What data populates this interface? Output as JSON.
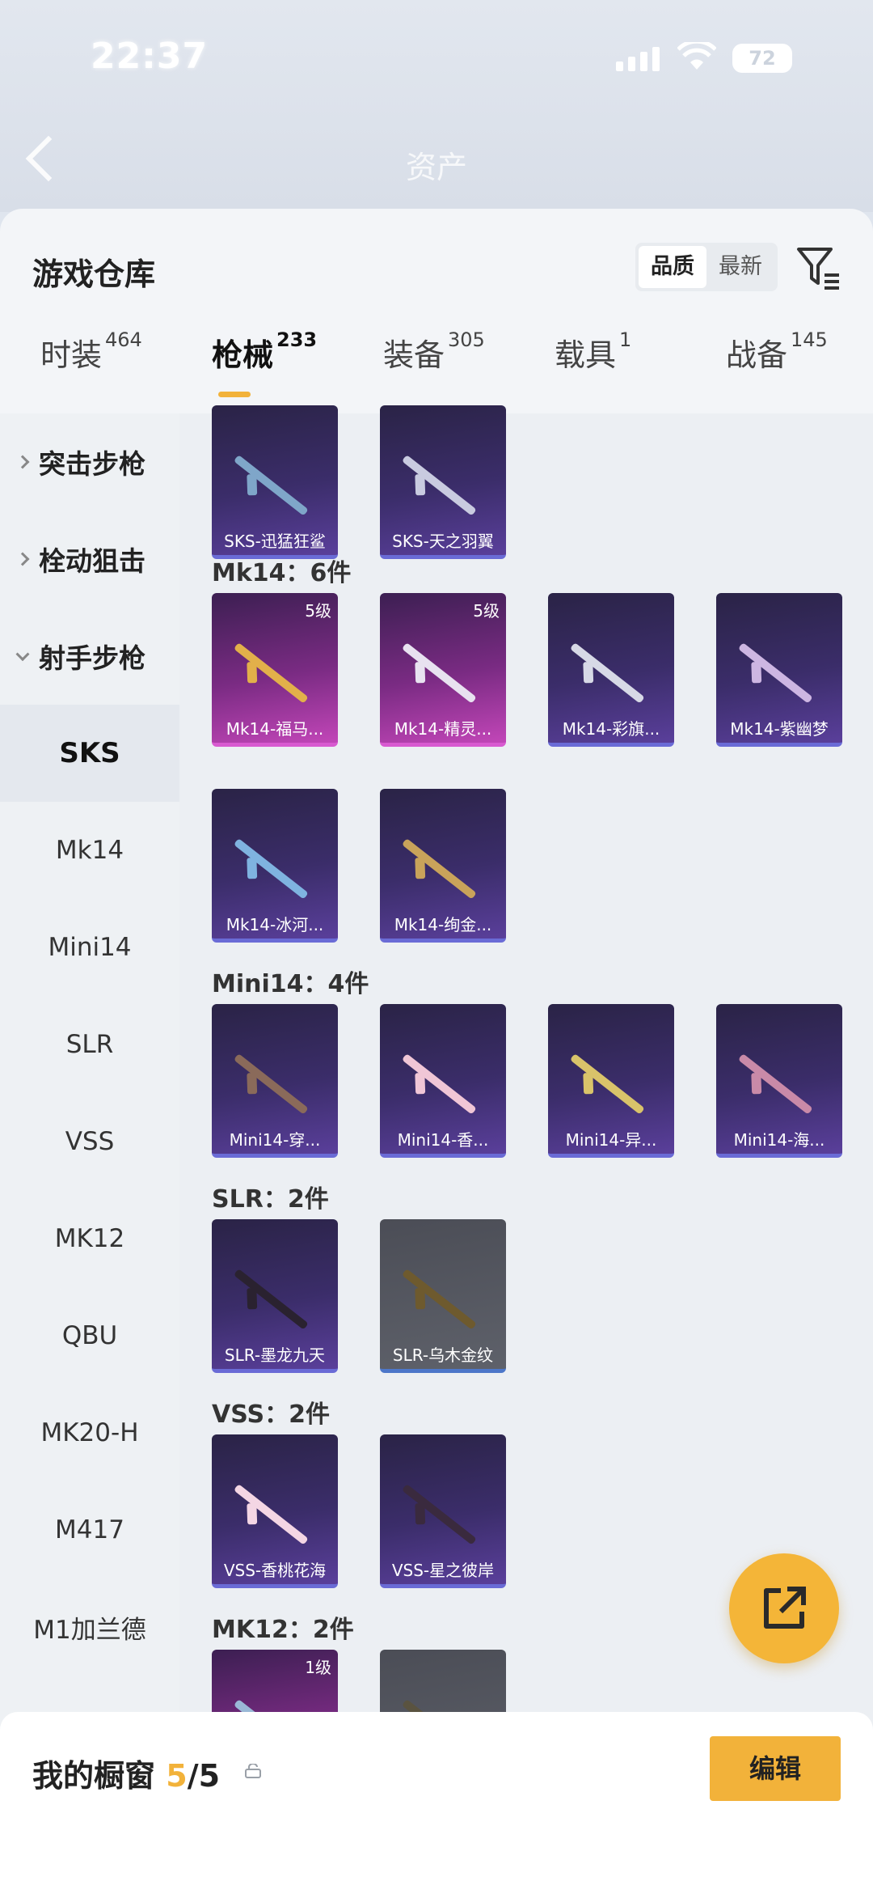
{
  "status": {
    "time": "22:37",
    "battery": "72"
  },
  "header": {
    "title": "资产"
  },
  "sheet": {
    "title": "游戏仓库",
    "sort": {
      "options": [
        "品质",
        "最新"
      ],
      "selected": "品质"
    }
  },
  "tabs": [
    {
      "label": "时装",
      "count": "464"
    },
    {
      "label": "枪械",
      "count": "233",
      "active": true
    },
    {
      "label": "装备",
      "count": "305"
    },
    {
      "label": "载具",
      "count": "1"
    },
    {
      "label": "战备",
      "count": "145"
    }
  ],
  "sidebar": {
    "categories": [
      "突击步枪",
      "栓动狙击",
      "射手步枪"
    ],
    "items": [
      "SKS",
      "Mk14",
      "Mini14",
      "SLR",
      "VSS",
      "MK12",
      "QBU",
      "MK20-H",
      "M417",
      "M1加兰德"
    ],
    "selected": "SKS"
  },
  "content": {
    "sks_cards": [
      "SKS-迅猛狂鲨",
      "SKS-天之羽翼"
    ],
    "sections": [
      {
        "title": "Mk14：6件",
        "cards": [
          {
            "name": "Mk14-福马...",
            "level": "5级"
          },
          {
            "name": "Mk14-精灵...",
            "level": "5级"
          },
          {
            "name": "Mk14-彩旗..."
          },
          {
            "name": "Mk14-紫幽梦"
          },
          {
            "name": "Mk14-冰河..."
          },
          {
            "name": "Mk14-绚金..."
          }
        ]
      },
      {
        "title": "Mini14：4件",
        "cards": [
          {
            "name": "Mini14-穿..."
          },
          {
            "name": "Mini14-香..."
          },
          {
            "name": "Mini14-异..."
          },
          {
            "name": "Mini14-海..."
          }
        ]
      },
      {
        "title": "SLR：2件",
        "cards": [
          {
            "name": "SLR-墨龙九天"
          },
          {
            "name": "SLR-乌木金纹"
          }
        ]
      },
      {
        "title": "VSS：2件",
        "cards": [
          {
            "name": "VSS-香桃花海"
          },
          {
            "name": "VSS-星之彼岸"
          }
        ]
      },
      {
        "title": "MK12：2件",
        "cards": [
          {
            "level": "1级"
          }
        ]
      }
    ]
  },
  "bottom": {
    "label": "我的橱窗",
    "count": "5",
    "total": "/5",
    "edit": "编辑"
  },
  "colors": {
    "accent": "#f2b23a",
    "purple_card": "#3b2d6a",
    "pink_card": "#c246b8",
    "gray_card": "#5e616a"
  }
}
